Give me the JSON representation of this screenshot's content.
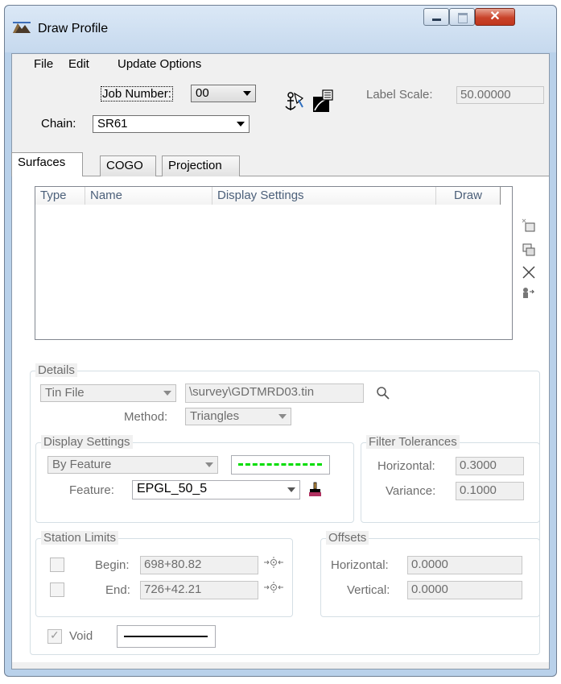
{
  "window": {
    "title": "Draw Profile"
  },
  "menu": [
    "File",
    "Edit",
    "Update Options"
  ],
  "header": {
    "job_number_label": "Job Number:",
    "job_number_value": "00",
    "chain_label": "Chain:",
    "chain_value": "SR61",
    "label_scale_label": "Label Scale:",
    "label_scale_value": "50.00000"
  },
  "tabs": [
    "Surfaces",
    "COGO",
    "Projection"
  ],
  "surfaces": {
    "columns": [
      "Type",
      "Name",
      "Display Settings",
      "Draw"
    ],
    "side_icons": [
      "add-icon",
      "copy-icon",
      "delete-icon",
      "import-icon"
    ]
  },
  "details": {
    "title": "Details",
    "source_type": "Tin File",
    "file_path": "\\survey\\GDTMRD03.tin",
    "method_label": "Method:",
    "method_value": "Triangles",
    "display_settings": {
      "title": "Display Settings",
      "mode": "By Feature",
      "feature_label": "Feature:",
      "feature_value": "EPGL_50_5",
      "line_color": "#00dd00"
    },
    "filter_tolerances": {
      "title": "Filter Tolerances",
      "horizontal_label": "Horizontal:",
      "horizontal_value": "0.3000",
      "variance_label": "Variance:",
      "variance_value": "0.1000"
    },
    "station_limits": {
      "title": "Station Limits",
      "begin_label": "Begin:",
      "begin_value": "698+80.82",
      "end_label": "End:",
      "end_value": "726+42.21"
    },
    "offsets": {
      "title": "Offsets",
      "horizontal_label": "Horizontal:",
      "horizontal_value": "0.0000",
      "vertical_label": "Vertical:",
      "vertical_value": "0.0000"
    },
    "void_label": "Void"
  }
}
